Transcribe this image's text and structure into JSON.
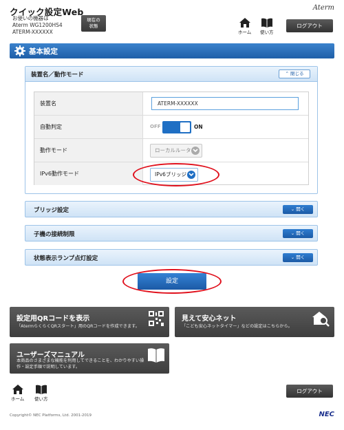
{
  "header": {
    "app_title": "クイック設定Web",
    "device_label_line1": "お使いの機器は",
    "device_label_line2": "Aterm WG1200HS4",
    "device_label_line3": "ATERM-XXXXXX",
    "status_button_line1": "現在の",
    "status_button_line2": "状態",
    "logo": "Aterm",
    "home_label": "ホーム",
    "manual_label": "使い方",
    "logout_label": "ログアウト"
  },
  "section": {
    "title": "基本設定"
  },
  "panel": {
    "title": "装置名／動作モード",
    "close_label": "閉じる",
    "rows": [
      {
        "label": "装置名",
        "value": "ATERM-XXXXXX"
      },
      {
        "label": "自動判定",
        "off": "OFF",
        "on": "ON"
      },
      {
        "label": "動作モード",
        "value": "ローカルルータ"
      },
      {
        "label": "IPv6動作モード",
        "value": "IPv6ブリッジ"
      }
    ]
  },
  "collapsed_sections": [
    {
      "title": "ブリッジ設定",
      "button": "開く"
    },
    {
      "title": "子機の接続制限",
      "button": "開く"
    },
    {
      "title": "状態表示ランプ点灯設定",
      "button": "開く"
    }
  ],
  "submit_label": "設定",
  "tiles": {
    "qr": {
      "title": "設定用QRコードを表示",
      "desc": "「AtermらくらくQRスタート」用のQRコードを作成できます。"
    },
    "safety": {
      "title": "見えて安心ネット",
      "desc": "「こども安心ネットタイマー」などの設定はこちらから。"
    },
    "manual": {
      "title": "ユーザーズマニュアル",
      "desc_line1": "本商品のさまざまな機能を利用してできることを、わかりやすい操",
      "desc_line2": "作・設定手順で説明しています。"
    }
  },
  "footer": {
    "home_label": "ホーム",
    "manual_label": "使い方",
    "logout_label": "ログアウト",
    "copyright": "Copyright© NEC Platforms, Ltd. 2001-2019",
    "nec_logo": "NEC"
  },
  "colors": {
    "accent": "#1f6fc4",
    "highlight": "#e0101c",
    "panel_border": "#9cc3e8"
  }
}
